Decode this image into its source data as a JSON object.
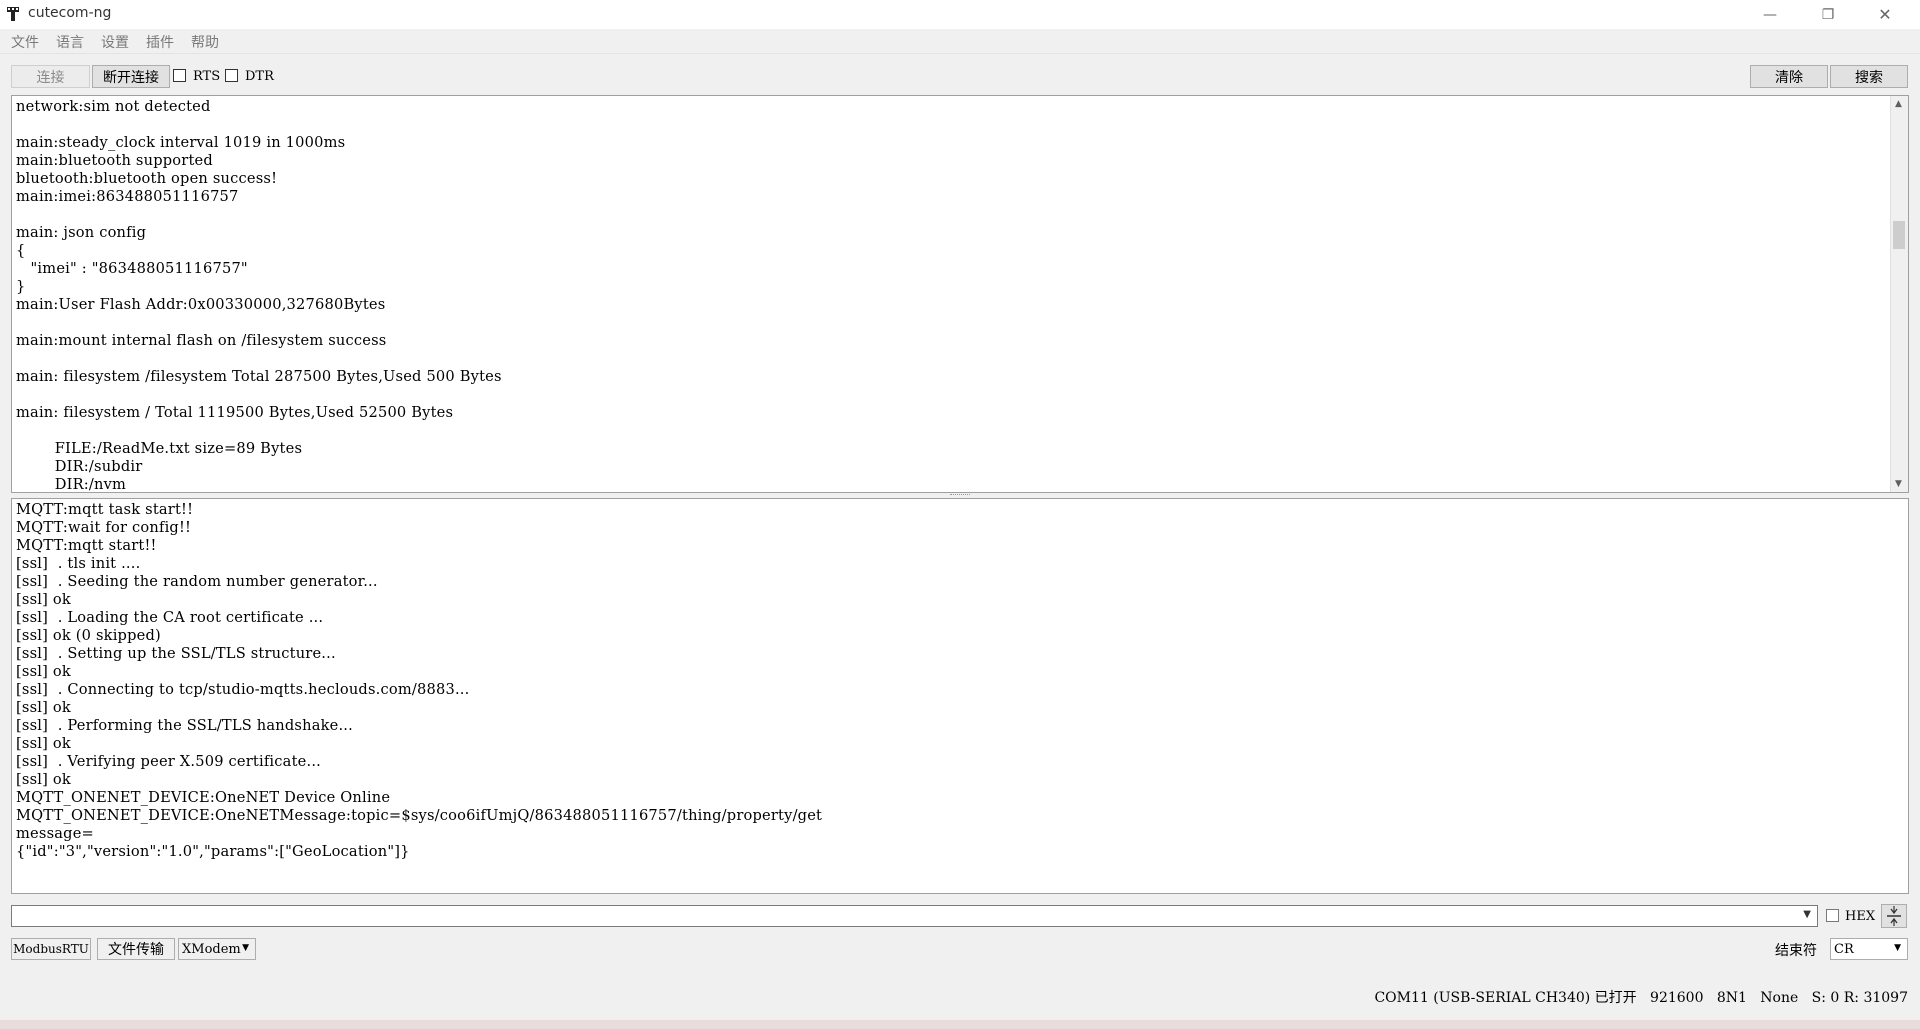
{
  "window": {
    "title": "cutecom-ng",
    "minimize_glyph": "—",
    "maximize_glyph": "❐",
    "close_glyph": "✕"
  },
  "menu": [
    "文件",
    "语言",
    "设置",
    "插件",
    "帮助"
  ],
  "toolbar": {
    "connect_label": "连接",
    "disconnect_label": "断开连接",
    "rts_label": "RTS",
    "dtr_label": "DTR",
    "clear_label": "清除",
    "search_label": "搜索"
  },
  "output_top": "network:sim not detected\n\nmain:steady_clock interval 1019 in 1000ms\nmain:bluetooth supported\nbluetooth:bluetooth open success!\nmain:imei:863488051116757\n\nmain: json config\n{\n   \"imei\" : \"863488051116757\"\n}\nmain:User Flash Addr:0x00330000,327680Bytes\n\nmain:mount internal flash on /filesystem success\n\nmain: filesystem /filesystem Total 287500 Bytes,Used 500 Bytes\n\nmain: filesystem / Total 1119500 Bytes,Used 52500 Bytes\n\n        FILE:/ReadMe.txt size=89 Bytes\n        DIR:/subdir\n        DIR:/nvm",
  "output_bottom": "MQTT:mqtt task start!!\nMQTT:wait for config!!\nMQTT:mqtt start!!\n[ssl]  . tls init ....\n[ssl]  . Seeding the random number generator...\n[ssl] ok\n[ssl]  . Loading the CA root certificate ...\n[ssl] ok (0 skipped)\n[ssl]  . Setting up the SSL/TLS structure...\n[ssl] ok\n[ssl]  . Connecting to tcp/studio-mqtts.heclouds.com/8883...\n[ssl] ok\n[ssl]  . Performing the SSL/TLS handshake...\n[ssl] ok\n[ssl]  . Verifying peer X.509 certificate...\n[ssl] ok\nMQTT_ONENET_DEVICE:OneNET Device Online\nMQTT_ONENET_DEVICE:OneNETMessage:topic=$sys/coo6ifUmjQ/863488051116757/thing/property/get\nmessage=\n{\"id\":\"3\",\"version\":\"1.0\",\"params\":[\"GeoLocation\"]}",
  "input": {
    "value": "",
    "hex_label": "HEX"
  },
  "bottom_bar": {
    "modbus_label": "ModbusRTU",
    "file_transfer_label": "文件传输",
    "protocol_value": "XModem",
    "line_end_label": "结束符",
    "line_end_value": "CR"
  },
  "status": {
    "port": "COM11 (USB-SERIAL CH340) 已打开",
    "baud": "921600",
    "format": "8N1",
    "flow": "None",
    "counters": "S: 0 R: 31097"
  }
}
